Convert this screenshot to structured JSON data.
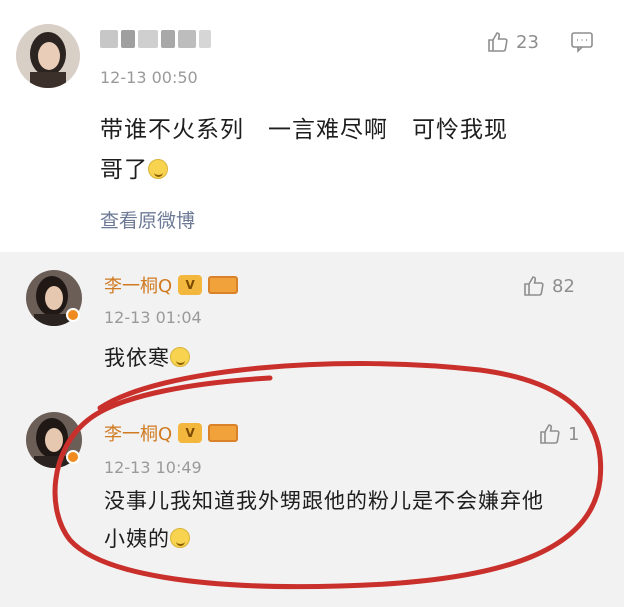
{
  "main_comment": {
    "timestamp": "12-13 00:50",
    "likes": "23",
    "text_line1": "带谁不火系列　一言难尽啊　可怜我现",
    "text_line2": "哥了",
    "view_original_label": "查看原微博"
  },
  "replies": [
    {
      "username": "李一桐Q",
      "timestamp": "12-13 01:04",
      "likes": "82",
      "text": "我依寒"
    },
    {
      "username": "李一桐Q",
      "timestamp": "12-13 10:49",
      "likes": "1",
      "text_line1": "没事儿我知道我外甥跟他的粉儿是不会嫌弃他",
      "text_line2": "小姨的"
    }
  ],
  "badges": {
    "vip": "V"
  },
  "colors": {
    "accent_username": "#d07b22",
    "link": "#6d7a96",
    "annotation": "#c9302c",
    "reply_bg": "#f2f2f2"
  },
  "icons": {
    "like": "thumbs-up-icon",
    "comment": "comment-icon",
    "emoji": "laughing-emoji-icon"
  }
}
